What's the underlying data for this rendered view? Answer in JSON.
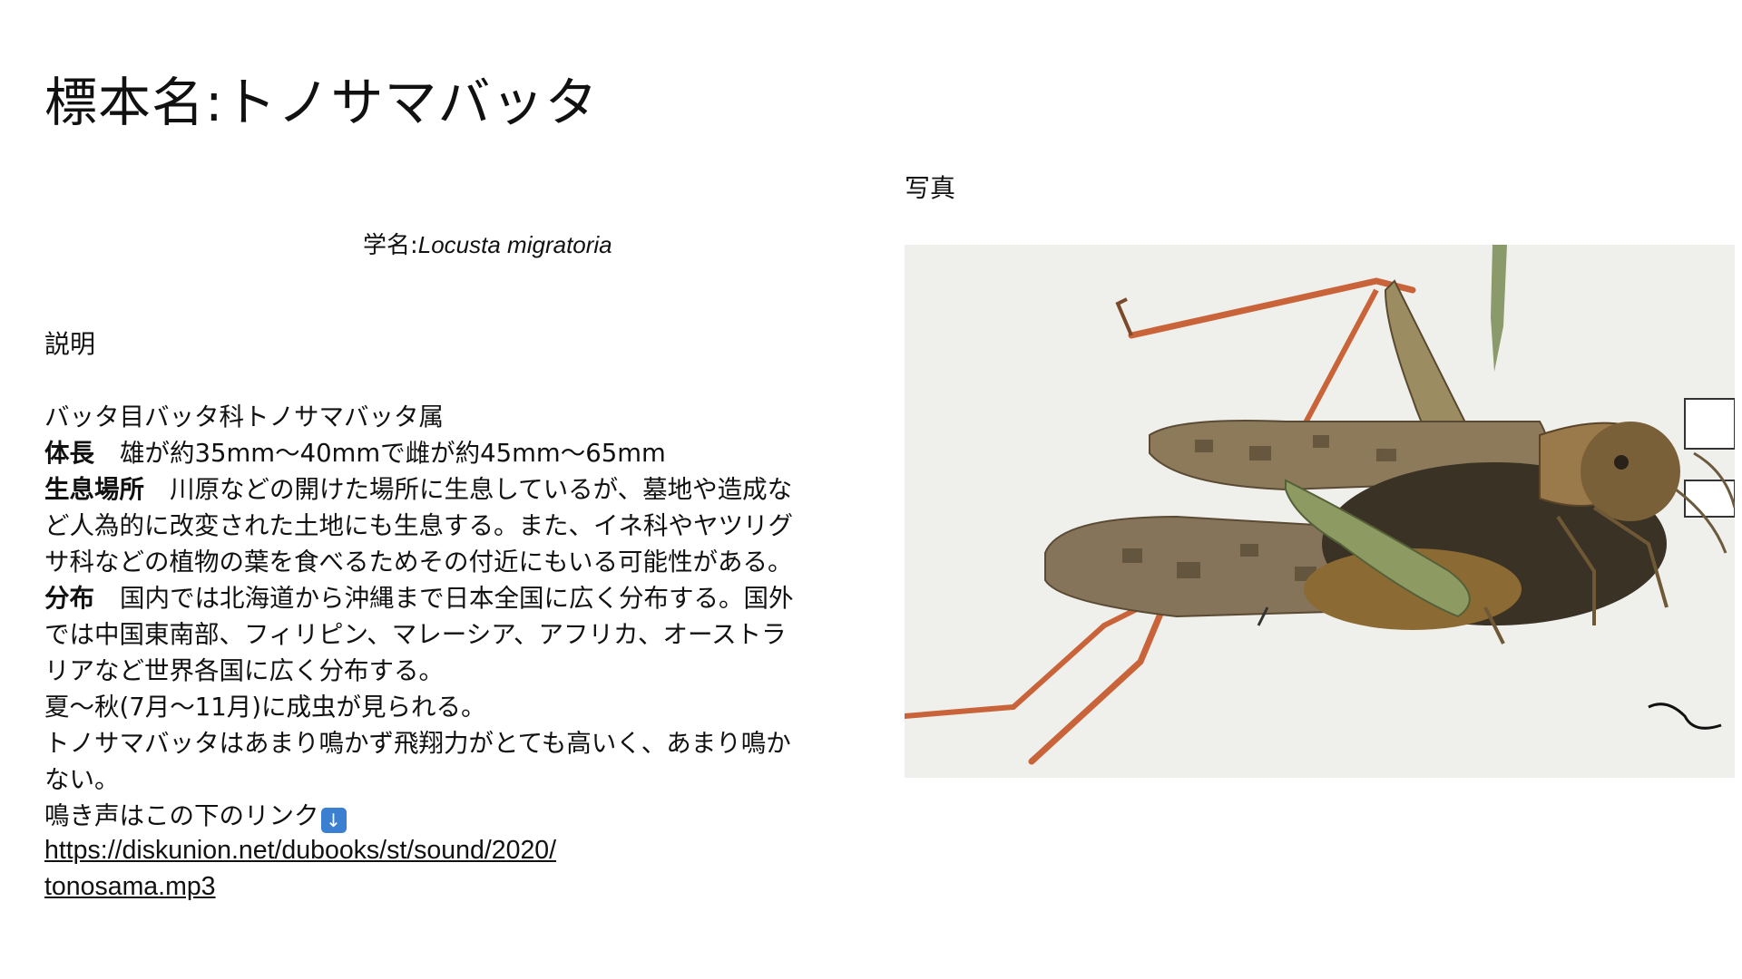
{
  "slide": {
    "title": "標本名:トノサマバッタ",
    "photo_label": "写真",
    "scientific_name_prefix": "学名:",
    "scientific_name": "Locusta migratoria",
    "description_label": "説明",
    "body": {
      "classification": "バッタ目バッタ科トノサマバッタ属",
      "body_length_label": "体長",
      "body_length": "雄が約35mm〜40mmで雌が約45mm〜65mm",
      "habitat_label": "生息場所",
      "habitat_line1": "川原などの開けた場所に生息しているが、墓地や造成な",
      "habitat_line2": "ど人為的に改変された土地にも生息する。また、イネ科やヤツリグ",
      "habitat_line3": "サ科などの植物の葉を食べるためその付近にもいる可能性がある。",
      "distribution_label": "分布",
      "distribution_line1": "国内では北海道から沖縄まで日本全国に広く分布する。国外",
      "distribution_line2": "では中国東南部、フィリピン、マレーシア、アフリカ、オーストラ",
      "distribution_line3": "リアなど世界各国に広く分布する。",
      "season": "夏〜秋(7月〜11月)に成虫が見られる。",
      "behavior_line1": "トノサマバッタはあまり鳴かず飛翔力がとても高いく、あまり鳴か",
      "behavior_line2": "ない。",
      "sound_note": "鳴き声はこの下のリンク",
      "arrow_icon": "down-arrow-icon"
    },
    "link_line1": "https://diskunion.net/dubooks/st/sound/2020/",
    "link_line2": "tonosama.mp3"
  }
}
